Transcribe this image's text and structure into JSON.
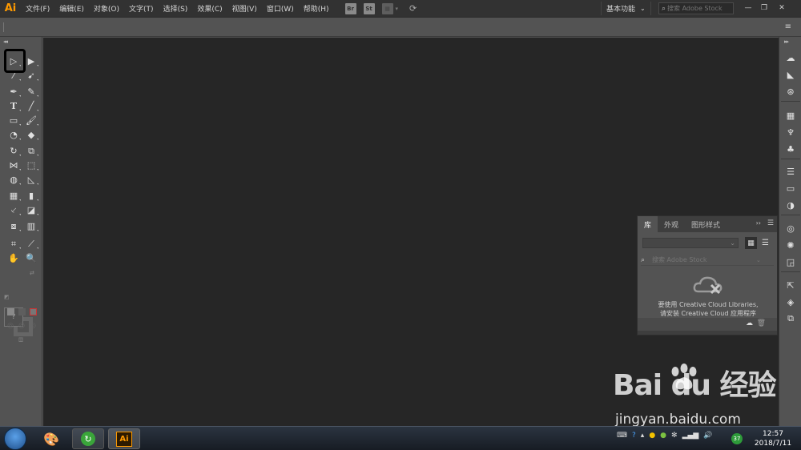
{
  "app": {
    "logo": "Ai"
  },
  "menubar": {
    "items": [
      "文件(F)",
      "编辑(E)",
      "对象(O)",
      "文字(T)",
      "选择(S)",
      "效果(C)",
      "视图(V)",
      "窗口(W)",
      "帮助(H)"
    ],
    "bridge_label": "Br",
    "stock_label": "St",
    "workspace": "基本功能",
    "stock_search_placeholder": "搜索 Adobe Stock"
  },
  "library_panel": {
    "tabs": [
      "库",
      "外观",
      "图形样式"
    ],
    "search_placeholder": "搜索 Adobe Stock",
    "message_line1": "要使用 Creative Cloud Libraries,",
    "message_line2": "请安装 Creative Cloud 应用程序"
  },
  "toolbar": {
    "fill_label": "?"
  },
  "watermark": {
    "text": "Bai  du 经验",
    "url": "jingyan.baidu.com"
  },
  "taskbar": {
    "ai_label": "Ai",
    "badge": "37",
    "time": "12:57",
    "date": "2018/7/11"
  },
  "colors": {
    "accent": "#ff9a00",
    "canvas": "#262626",
    "panel": "#535353"
  }
}
